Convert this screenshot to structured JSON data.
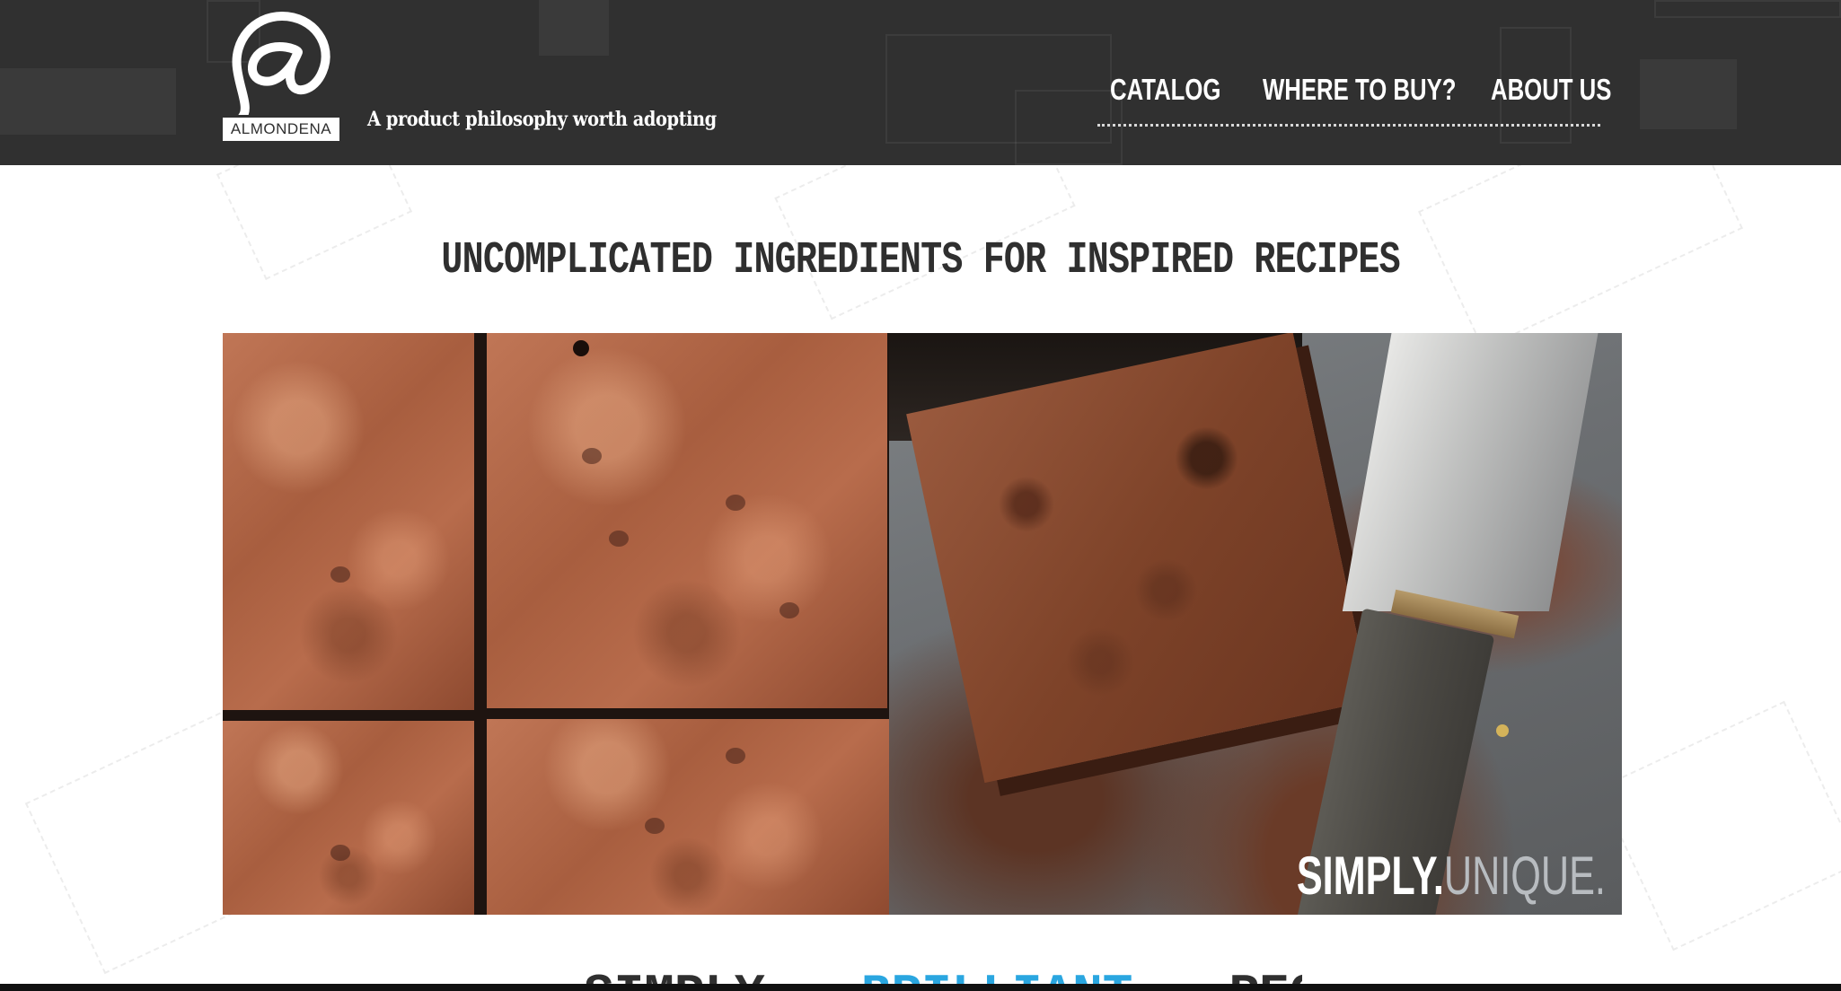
{
  "header": {
    "logo_text": "ALMONDENA",
    "tagline": "A product philosophy worth adopting",
    "nav": [
      {
        "label": "CATALOG"
      },
      {
        "label": "WHERE TO BUY?"
      },
      {
        "label": "ABOUT US"
      }
    ]
  },
  "main": {
    "headline": "UNCOMPLICATED INGREDIENTS FOR INSPIRED RECIPES",
    "hero": {
      "caption_part1": "SIMPLY.",
      "caption_part2": "UNIQUE."
    },
    "next_heading": {
      "part1": "SIMPLY",
      "part2": "BRILLIANT",
      "part3": "RECIPES"
    }
  },
  "colors": {
    "header_bg": "#303030",
    "accent_blue": "#2aa6e0",
    "text_dark": "#2f2f2f"
  }
}
